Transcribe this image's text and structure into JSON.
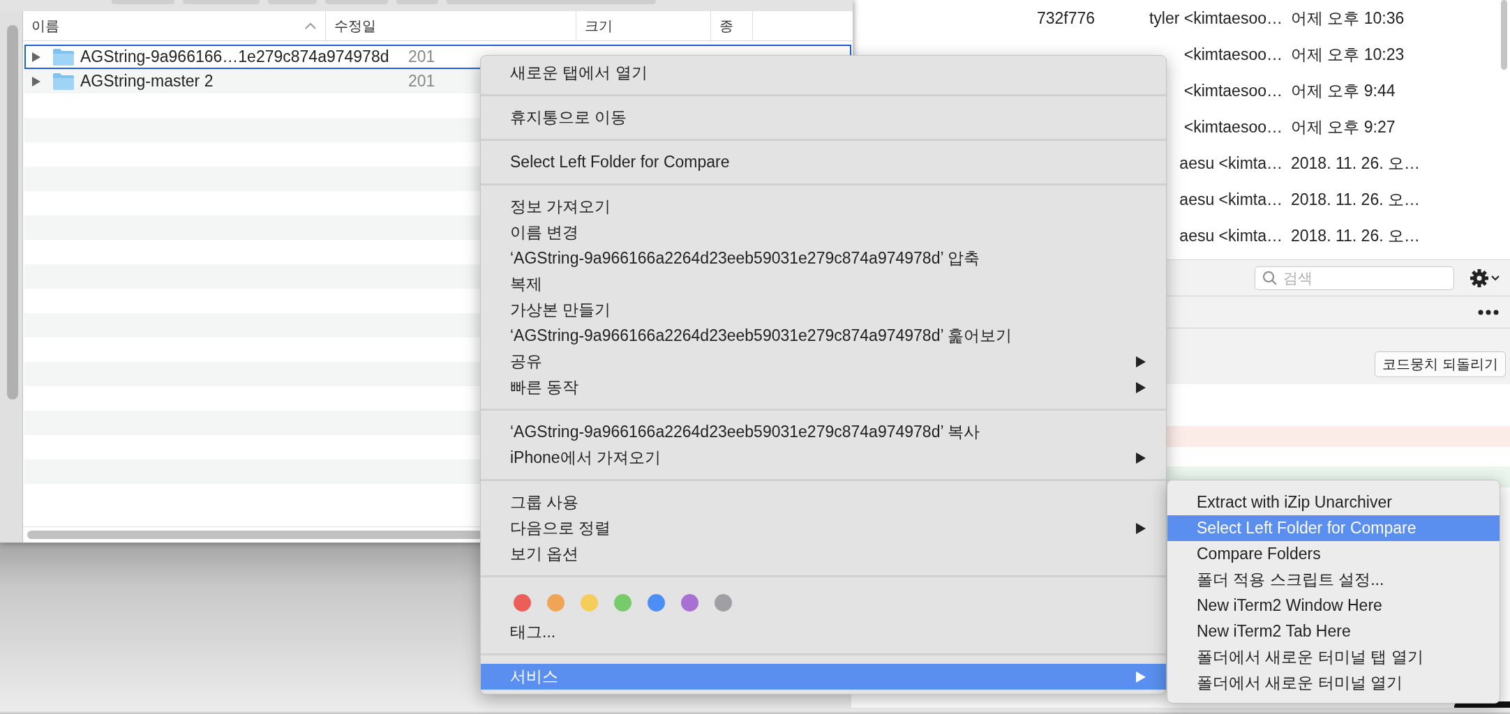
{
  "finder": {
    "columns": [
      {
        "label": "이름",
        "sorted": true
      },
      {
        "label": "수정일",
        "sorted": false
      },
      {
        "label": "크기",
        "sorted": false
      },
      {
        "label": "종",
        "sorted": false
      }
    ],
    "rows": [
      {
        "name": "AGString-9a966166…1e279c874a974978d",
        "modified": "201",
        "expanded": false,
        "selected": true
      },
      {
        "name": "AGString-master 2",
        "modified": "201",
        "expanded": false,
        "selected": false
      }
    ]
  },
  "git": {
    "commits": [
      {
        "hash": "732f776",
        "author": "tyler <kimtaesoo…",
        "date": "어제 오후 10:36"
      },
      {
        "author": "<kimtaesoo…",
        "date": "어제 오후 10:23"
      },
      {
        "author": "<kimtaesoo…",
        "date": "어제 오후 9:44"
      },
      {
        "author": "<kimtaesoo…",
        "date": "어제 오후 9:27"
      },
      {
        "author": "aesu <kimta…",
        "date": "2018. 11. 26. 오…"
      },
      {
        "author": "aesu <kimta…",
        "date": "2018. 11. 26. 오…"
      },
      {
        "author": "aesu <kimta…",
        "date": "2018. 11. 26. 오…"
      }
    ],
    "search": {
      "placeholder": "검색"
    },
    "revert_button": "코드뭉치 되돌리기",
    "diff_lines": [
      {
        "kind": "removed"
      },
      {
        "kind": "added"
      }
    ]
  },
  "context_menu": {
    "sections": [
      {
        "items": [
          {
            "kind": "item",
            "label": "새로운 탭에서 열기",
            "submenu": false,
            "selected": false
          }
        ]
      },
      {
        "items": [
          {
            "kind": "item",
            "label": "휴지통으로 이동",
            "submenu": false,
            "selected": false
          }
        ]
      },
      {
        "items": [
          {
            "kind": "item",
            "label": "Select Left Folder for Compare",
            "submenu": false,
            "selected": false
          }
        ]
      },
      {
        "items": [
          {
            "kind": "item",
            "label": "정보 가져오기",
            "submenu": false,
            "selected": false
          },
          {
            "kind": "item",
            "label": "이름 변경",
            "submenu": false,
            "selected": false
          },
          {
            "kind": "item",
            "label": "‘AGString-9a966166a2264d23eeb59031e279c874a974978d’ 압축",
            "submenu": false,
            "selected": false
          },
          {
            "kind": "item",
            "label": "복제",
            "submenu": false,
            "selected": false
          },
          {
            "kind": "item",
            "label": "가상본 만들기",
            "submenu": false,
            "selected": false
          },
          {
            "kind": "item",
            "label": "‘AGString-9a966166a2264d23eeb59031e279c874a974978d’ 훑어보기",
            "submenu": false,
            "selected": false
          },
          {
            "kind": "item",
            "label": "공유",
            "submenu": true,
            "selected": false
          },
          {
            "kind": "item",
            "label": "빠른 동작",
            "submenu": true,
            "selected": false
          }
        ]
      },
      {
        "items": [
          {
            "kind": "item",
            "label": "‘AGString-9a966166a2264d23eeb59031e279c874a974978d’ 복사",
            "submenu": false,
            "selected": false
          },
          {
            "kind": "item",
            "label": "iPhone에서 가져오기",
            "submenu": true,
            "selected": false
          }
        ]
      },
      {
        "items": [
          {
            "kind": "item",
            "label": "그룹 사용",
            "submenu": false,
            "selected": false
          },
          {
            "kind": "item",
            "label": "다음으로 정렬",
            "submenu": true,
            "selected": false
          },
          {
            "kind": "item",
            "label": "보기 옵션",
            "submenu": false,
            "selected": false
          }
        ]
      },
      {
        "items": [
          {
            "kind": "tags",
            "colors": [
              {
                "color": "#ec5f59"
              },
              {
                "color": "#f0a455"
              },
              {
                "color": "#f5cd5b"
              },
              {
                "color": "#78cb6a"
              },
              {
                "color": "#4d8ef5"
              },
              {
                "color": "#a870d3"
              },
              {
                "color": "#a0a0a4"
              }
            ]
          },
          {
            "kind": "item",
            "label": "태그...",
            "submenu": false,
            "selected": false
          }
        ]
      },
      {
        "items": [
          {
            "kind": "item",
            "label": "서비스",
            "submenu": true,
            "selected": true
          }
        ]
      }
    ]
  },
  "services_submenu": {
    "items": [
      {
        "label": "Extract with iZip Unarchiver",
        "selected": false
      },
      {
        "label": "Select Left Folder for Compare",
        "selected": true
      },
      {
        "label": "Compare Folders",
        "selected": false
      },
      {
        "label": "폴더 적용 스크립트 설정...",
        "selected": false
      },
      {
        "label": "New iTerm2 Window Here",
        "selected": false
      },
      {
        "label": "New iTerm2 Tab Here",
        "selected": false
      },
      {
        "label": "폴더에서 새로운 터미널 탭 열기",
        "selected": false
      },
      {
        "label": "폴더에서 새로운 터미널 열기",
        "selected": false
      }
    ]
  }
}
